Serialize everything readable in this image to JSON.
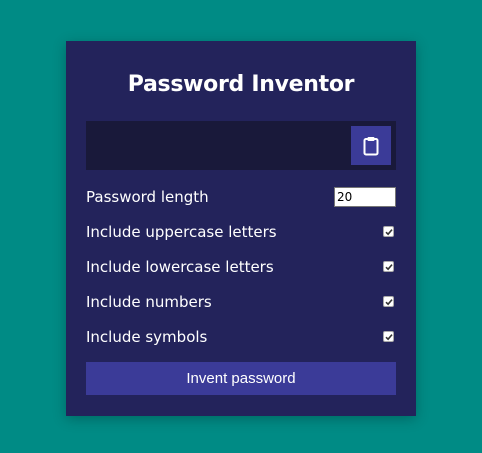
{
  "app": {
    "title": "Password Inventor"
  },
  "result": {
    "password": "",
    "clipboard_icon": "clipboard-icon"
  },
  "settings": {
    "length": {
      "label": "Password length",
      "value": "20"
    },
    "options": [
      {
        "label": "Include uppercase letters",
        "checked": true
      },
      {
        "label": "Include lowercase letters",
        "checked": true
      },
      {
        "label": "Include numbers",
        "checked": true
      },
      {
        "label": "Include symbols",
        "checked": true
      }
    ]
  },
  "actions": {
    "generate_label": "Invent password"
  },
  "colors": {
    "background": "#008b85",
    "card": "#23235b",
    "result_bg": "#19193a",
    "accent": "#3b3b98"
  }
}
